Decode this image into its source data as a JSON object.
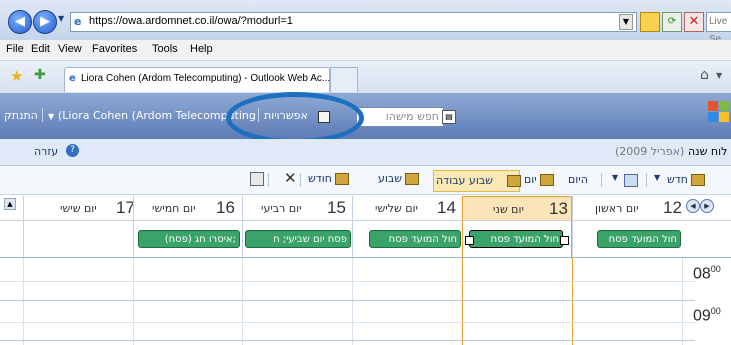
{
  "browser": {
    "url": "https://owa.ardomnet.co.il/owa/?modurl=1",
    "search_placeholder": "Live Se",
    "tab_title": "Liora Cohen (Ardom Telecomputing) - Outlook Web Ac...",
    "menu": [
      "File",
      "Edit",
      "View",
      "Favorites",
      "Tools",
      "Help"
    ]
  },
  "owa_header": {
    "logout": "התנתק",
    "user": "(Liora Cohen (Ardom Telecomputing",
    "options": "אפשרויות",
    "search_placeholder": "חפש מישהו"
  },
  "subheader": {
    "help": "עזרה",
    "view_title": "לוח שנה",
    "month": "(אפריל 2009)"
  },
  "toolbar": {
    "new": "חדש",
    "today": "היום",
    "day": "יום",
    "work_week": "שבוע עבודה",
    "week": "שבוע",
    "month": "חודש"
  },
  "calendar": {
    "days": [
      {
        "num": "12",
        "name": "יום ראשון",
        "event": "חול המועד פסח"
      },
      {
        "num": "13",
        "name": "יום שני",
        "event": "חול המועד פסח"
      },
      {
        "num": "14",
        "name": "יום שלישי",
        "event": "חול המועד פסח"
      },
      {
        "num": "15",
        "name": "יום רביעי",
        "event": "פסח יום שביעי; ח"
      },
      {
        "num": "16",
        "name": "יום חמישי",
        "event": "איסרו חג (פסח);"
      },
      {
        "num": "17",
        "name": "יום שישי",
        "event": ""
      }
    ],
    "times": [
      "08",
      "09"
    ],
    "time_suffix": "00"
  },
  "colors": {
    "header_blue": "#6d8cc4",
    "today_orange": "#f0a030",
    "event_green": "#3aa36a",
    "highlight_ellipse": "#1e6fc1"
  }
}
